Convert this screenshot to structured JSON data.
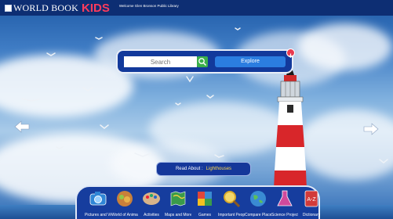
{
  "header": {
    "logo_text": "WORLD BOOK",
    "logo_kids": "KIDS",
    "welcome_text": "Welcome Glen Bronson Public Library"
  },
  "search": {
    "placeholder": "Search",
    "search_button_icon": "search-icon",
    "explore_label": "Explore",
    "badge_icon": "download-arrow-icon"
  },
  "nav": {
    "left_icon": "left-arrow-icon",
    "right_icon": "right-arrow-icon"
  },
  "read_about": {
    "label": "Read About :",
    "topic": "Lighthouses"
  },
  "dock": {
    "items": [
      {
        "label": "Pictures and Videos",
        "icon": "camera-icon",
        "color": "#2f86d6"
      },
      {
        "label": "World of Animals",
        "icon": "animals-icon",
        "color": "#c9803a"
      },
      {
        "label": "Activities",
        "icon": "palette-icon",
        "color": "#d7b48a"
      },
      {
        "label": "Maps and More",
        "icon": "map-icon",
        "color": "#3a9b4a"
      },
      {
        "label": "Games",
        "icon": "puzzle-icon",
        "color": "#e0463a"
      },
      {
        "label": "Important People",
        "icon": "magnifier-icon",
        "color": "#d8a92b"
      },
      {
        "label": "Compare Places",
        "icon": "globe-icon",
        "color": "#3a8bd3"
      },
      {
        "label": "Science Projects",
        "icon": "flask-icon",
        "color": "#cf4a9c"
      },
      {
        "label": "Dictionary",
        "icon": "dictionary-icon",
        "color": "#d23a3a"
      }
    ]
  },
  "colors": {
    "topbar": "#0d2e73",
    "kids_red": "#ff3b5c",
    "panel_blue": "#12399b",
    "explore_blue": "#2b7de0",
    "search_green": "#3bb04a",
    "topic_yellow": "#ffd84a"
  }
}
